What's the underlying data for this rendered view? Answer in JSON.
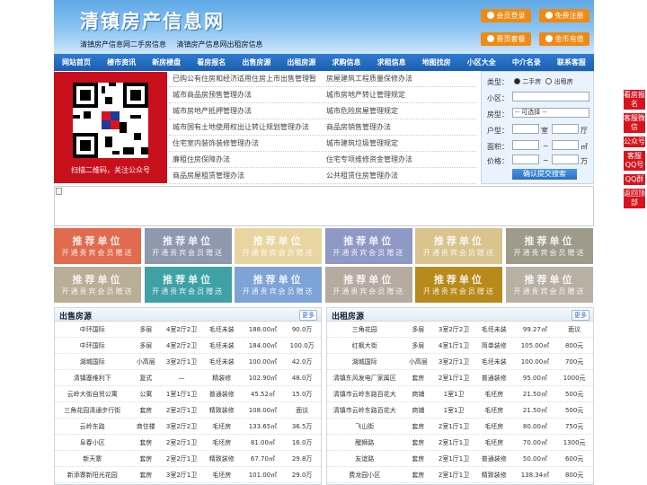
{
  "header": {
    "title": "清镇房产信息网",
    "link1": "清镇房产信息网二手房信息",
    "link2": "清镇房产信息网出租房信息",
    "buttons": [
      {
        "label": "会员登录"
      },
      {
        "label": "免费注册"
      },
      {
        "label": "费页套餐"
      },
      {
        "label": "金币充值"
      }
    ]
  },
  "nav": [
    "网站首页",
    "楼市资讯",
    "新房楼盘",
    "看房报名",
    "出售房源",
    "出租房源",
    "求购信息",
    "求租信息",
    "地图找房",
    "小区大全",
    "中介名录",
    "联系客服"
  ],
  "qr": {
    "caption": "扫描二维码，关注公众号"
  },
  "links": [
    [
      "已购公有住房和经济适用住房上市出售管理暂",
      "房屋建筑工程质量保修办法"
    ],
    [
      "城市商品房预售管理办法",
      "城市房地产转让管理规定"
    ],
    [
      "城市房地产抵押管理办法",
      "城市危险房屋管理规定"
    ],
    [
      "城市国有土地使用权出让转让规划管理办法",
      "商品房销售管理办法"
    ],
    [
      "住宅室内装饰装修管理办法",
      "城市建筑垃圾管理规定"
    ],
    [
      "廉租住房保障办法",
      "住宅专项维修资金管理办法"
    ],
    [
      "商品房屋租赁管理办法",
      "公共租赁住房管理办法"
    ]
  ],
  "search": {
    "type_label": "类型：",
    "opt1": "二手房",
    "opt2": "出租房",
    "area_label": "小区：",
    "house_label": "房型：",
    "house_value": "-- 可选择 --",
    "rooms_label": "户型：",
    "room_unit": "室",
    "hall_unit": "厅",
    "size_label": "面积：",
    "size_unit": "㎡",
    "price_label": "价格：",
    "price_unit": "万",
    "button": "确认提交搜索"
  },
  "rec": {
    "line1": "推荐单位",
    "line2": "开通贵宾会员赠送",
    "colors": [
      "#e06b4e",
      "#8e99b0",
      "#e8d5a0",
      "#8f99c6",
      "#d9c48e",
      "#9e9b8a",
      "#b9ae96",
      "#3fa1a6",
      "#7ea3d6",
      "#b6aba0",
      "#b78a1c",
      "#b9b0a4"
    ]
  },
  "sale": {
    "title": "出售房源",
    "more": "更多",
    "rows": [
      [
        "中环国际",
        "多层",
        "4室2厅2卫",
        "毛坯未装",
        "188.00㎡",
        "90.0万"
      ],
      [
        "中环国际",
        "多层",
        "4室2厅2卫",
        "毛坯未装",
        "184.00㎡",
        "100.0万"
      ],
      [
        "湖城国际",
        "小高层",
        "3室2厅1卫",
        "毛坯未装",
        "100.00㎡",
        "42.0万"
      ],
      [
        "清镇塞维利下",
        "复式",
        "—",
        "精装修",
        "102.90㎡",
        "48.0万"
      ],
      [
        "云岭大街自贸公寓",
        "公寓",
        "1室1厅1卫",
        "普通装修",
        "45.52㎡",
        "15.0万"
      ],
      [
        "三角花园清通步行街",
        "套房",
        "2室2厅1卫",
        "精致装修",
        "108.00㎡",
        "面议"
      ],
      [
        "云岭东路",
        "商住楼",
        "3室2厅2卫",
        "毛坯房",
        "133.65㎡",
        "36.5万"
      ],
      [
        "阜春小区",
        "套房",
        "2室2厅1卫",
        "毛坯房",
        "81.00㎡",
        "16.0万"
      ],
      [
        "新天寨",
        "套房",
        "2室2厅1卫",
        "精致装修",
        "67.70㎡",
        "29.8万"
      ],
      [
        "新添寨新阳光花园",
        "套房",
        "3室2厅1卫",
        "毛坯房",
        "101.00㎡",
        "29.0万"
      ]
    ]
  },
  "rent": {
    "title": "出租房源",
    "more": "更多",
    "rows": [
      [
        "三角花园",
        "多层",
        "3室2厅2卫",
        "毛坯未装",
        "99.27㎡",
        "面议"
      ],
      [
        "红枫大街",
        "多层",
        "4室1厅1卫",
        "简单装修",
        "105.00㎡",
        "800元"
      ],
      [
        "湖城国际",
        "小高层",
        "3室2厅1卫",
        "毛坯未装",
        "100.00㎡",
        "700元"
      ],
      [
        "清镇东风发电厂家属区",
        "套房",
        "2室1厅1卫",
        "普通装修",
        "95.00㎡",
        "1000元"
      ],
      [
        "清镇市云岭东路百花大",
        "商铺",
        "1室1卫",
        "毛坯房",
        "21.50㎡",
        "500元"
      ],
      [
        "清镇市云岭东路百花大",
        "商铺",
        "1室1卫",
        "毛坯房",
        "21.50㎡",
        "500元"
      ],
      [
        "飞山街",
        "套房",
        "2室1厅1卫",
        "毛坯房",
        "80.00㎡",
        "750元"
      ],
      [
        "醒狮路",
        "套房",
        "2室1厅1卫",
        "毛坯房",
        "70.00㎡",
        "1300元"
      ],
      [
        "友谊路",
        "套房",
        "2室1厅1卫",
        "普通装修",
        "50.00㎡",
        "600元"
      ],
      [
        "费龙园小区",
        "套房",
        "2室1厅1卫",
        "精致装修",
        "138.34㎡",
        "800元"
      ]
    ]
  },
  "side": [
    "看房报名",
    "客服微信",
    "公众号",
    "客服QQ号",
    "QQ群",
    "返回顶部"
  ]
}
